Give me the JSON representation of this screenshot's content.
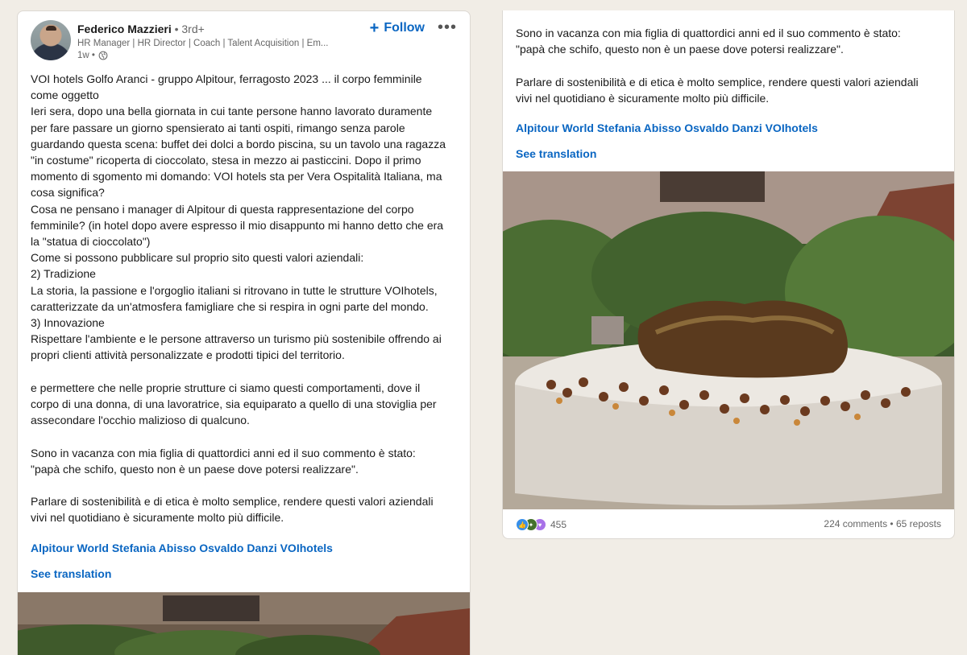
{
  "left_post": {
    "author": {
      "name": "Federico Mazzieri",
      "degree": "• 3rd+",
      "headline": "HR Manager | HR Director | Coach | Talent Acquisition | Em...",
      "time": "1w •"
    },
    "follow_label": "Follow",
    "text_lines": [
      "VOI hotels Golfo Aranci - gruppo Alpitour, ferragosto 2023 ... il corpo femminile",
      "come oggetto",
      "Ieri sera, dopo una bella giornata in cui tante persone hanno lavorato duramente",
      "per fare passare un giorno spensierato ai tanti ospiti, rimango senza parole",
      "guardando questa scena: buffet dei dolci a bordo piscina, su un tavolo una ragazza",
      "\"in costume\" ricoperta di cioccolato, stesa in mezzo ai pasticcini. Dopo il primo",
      "momento di sgomento mi domando: VOI hotels sta per Vera Ospitalità Italiana, ma",
      "cosa significa?",
      "Cosa ne pensano i manager di Alpitour di questa rappresentazione del corpo",
      "femminile? (in hotel dopo avere espresso il mio disappunto mi hanno detto che era",
      "la \"statua di cioccolato\")",
      "Come si possono pubblicare sul proprio sito questi valori aziendali:",
      "2) Tradizione",
      "La storia, la passione e l'orgoglio italiani si ritrovano in tutte le strutture VOIhotels,",
      "caratterizzate da un'atmosfera famigliare che si respira in ogni parte del mondo.",
      "3) Innovazione",
      "Rispettare l'ambiente e le persone attraverso un turismo più sostenibile offrendo ai",
      "propri clienti attività personalizzate e prodotti tipici del territorio.",
      "",
      "e permettere che nelle proprie strutture ci siamo questi comportamenti, dove il",
      "corpo di una donna, di una lavoratrice, sia equiparato a quello di una stoviglia per",
      "assecondare l'occhio malizioso di qualcuno.",
      "",
      "Sono in vacanza con mia figlia di quattordici anni ed il suo commento è stato:",
      "\"papà che schifo, questo non è un paese dove potersi realizzare\".",
      "",
      "Parlare di sostenibilità e di etica è molto semplice, rendere questi valori aziendali",
      "vivi nel quotidiano è sicuramente molto più difficile."
    ],
    "hashtags": "Alpitour World Stefania Abisso Osvaldo Danzi VOIhotels",
    "see_translation": "See translation"
  },
  "right_post": {
    "text_lines": [
      "Sono in vacanza con mia figlia di quattordici anni ed il suo commento è stato:",
      "\"papà che schifo, questo non è un paese dove potersi realizzare\".",
      "",
      "Parlare di sostenibilità e di etica è molto semplice, rendere questi valori aziendali",
      "vivi nel quotidiano è sicuramente molto più difficile."
    ],
    "hashtags": "Alpitour World Stefania Abisso Osvaldo Danzi VOIhotels",
    "see_translation": "See translation",
    "social": {
      "reactions": "455",
      "reaction_icons": [
        "like-icon",
        "celebrate-icon",
        "support-icon"
      ],
      "comments_reposts": "224 comments • 65 reposts"
    }
  },
  "colors": {
    "background": "#f1ede6",
    "link": "#0a66c2",
    "text": "#1a1a1a",
    "muted": "#666666"
  }
}
